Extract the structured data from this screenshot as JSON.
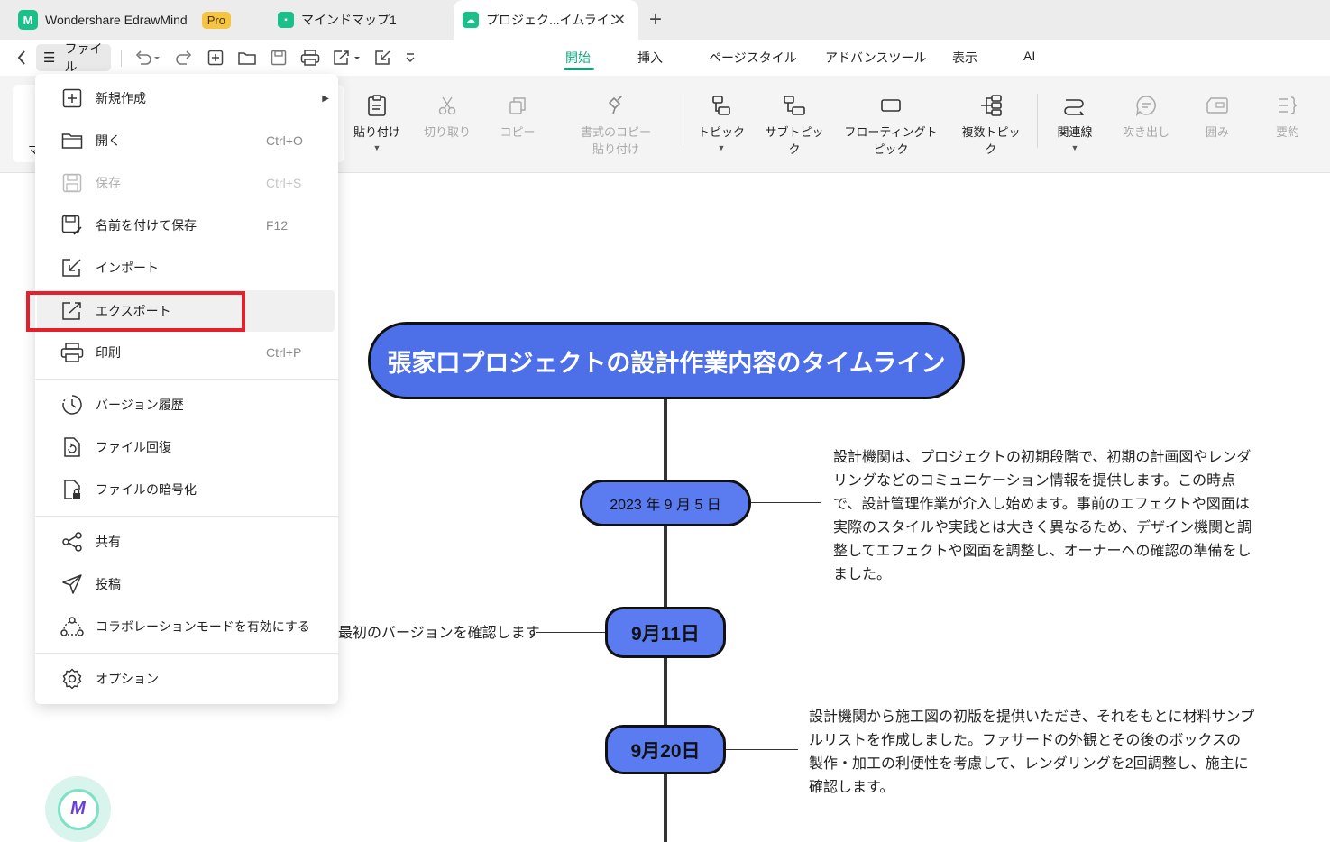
{
  "tabs": {
    "app_name": "Wondershare EdrawMind",
    "pro_badge": "Pro",
    "doc1": "マインドマップ1",
    "doc2": "プロジェク...イムライン",
    "close": "✕",
    "new_tab": "+"
  },
  "menubar": {
    "file_label": "ファイル",
    "ribbon_tabs": [
      "開始",
      "挿入",
      "ページスタイル",
      "アドバンスツール",
      "表示",
      "AI"
    ],
    "active_tab": "開始"
  },
  "ribbon": {
    "left_partial": "マ",
    "paste": "貼り付け",
    "cut": "切り取り",
    "copy": "コピー",
    "format_copy_line1": "書式のコピー",
    "format_copy_line2": "貼り付け",
    "topic": "トピック",
    "subtopic": "サブトピック",
    "floating_topic": "フローティングトピック",
    "multi_topic": "複数トピック",
    "relation": "関連線",
    "callout": "吹き出し",
    "boundary": "囲み",
    "summary": "要約"
  },
  "file_menu": {
    "new": "新規作成",
    "open": "開く",
    "open_shortcut": "Ctrl+O",
    "save": "保存",
    "save_shortcut": "Ctrl+S",
    "save_as": "名前を付けて保存",
    "save_as_shortcut": "F12",
    "import": "インポート",
    "export": "エクスポート",
    "print": "印刷",
    "print_shortcut": "Ctrl+P",
    "version_history": "バージョン履歴",
    "file_recovery": "ファイル回復",
    "file_encrypt": "ファイルの暗号化",
    "share": "共有",
    "post": "投稿",
    "collab": "コラボレーションモードを有効にする",
    "options": "オプション"
  },
  "canvas": {
    "main_title": "張家口プロジェクトの設計作業内容のタイムライン",
    "date1": "2023 年 9 月 5 日",
    "date2": "9月11日",
    "date3": "9月20日",
    "note1": "設計機関は、プロジェクトの初期段階で、初期の計画図やレンダリングなどのコミュニケーション情報を提供します。この時点で、設計管理作業が介入し始めます。事前のエフェクトや図面は実際のスタイルや実践とは大きく異なるため、デザイン機関と調整してエフェクトや図面を調整し、オーナーへの確認の準備をしました。",
    "note2": "最初のバージョンを確認します",
    "note3": "設計機関から施工図の初版を提供いただき、それをもとに材料サンプルリストを作成しました。ファサードの外観とその後のボックスの製作・加工の利便性を考慮して、レンダリングを2回調整し、施主に確認します。"
  },
  "colors": {
    "accent": "#12a37d",
    "node_blue": "#4d6fe8",
    "highlight_red": "#e6202a"
  }
}
